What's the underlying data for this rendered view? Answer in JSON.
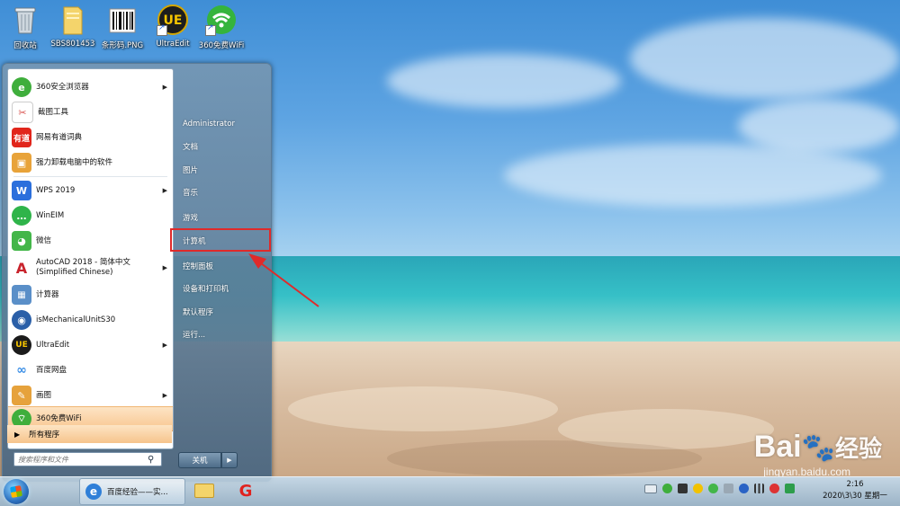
{
  "desktop": {
    "icons": [
      {
        "label": "回收站",
        "icon": "recycle-bin-icon"
      },
      {
        "label": "SBS801453",
        "icon": "folder-icon"
      },
      {
        "label": "条形码.PNG",
        "icon": "barcode-image-icon"
      },
      {
        "label": "UltraEdit",
        "icon": "ultraedit-icon"
      },
      {
        "label": "360免费WiFi",
        "icon": "wifi-icon"
      }
    ]
  },
  "start_menu": {
    "programs": [
      {
        "label": "360安全浏览器",
        "has_submenu": true,
        "color": "#3fae3c"
      },
      {
        "label": "截图工具",
        "has_submenu": false,
        "color": "#d9534f"
      },
      {
        "label": "网易有道词典",
        "has_submenu": false,
        "color": "#e1251b"
      },
      {
        "label": "强力卸载电脑中的软件",
        "has_submenu": false,
        "color": "#e8a33a"
      },
      {
        "label": "WPS 2019",
        "has_submenu": true,
        "color": "#2b6fdc"
      },
      {
        "label": "WinEIM",
        "has_submenu": false,
        "color": "#2fb44a"
      },
      {
        "label": "微信",
        "has_submenu": false,
        "color": "#43b649"
      },
      {
        "label": "AutoCAD 2018 - 简体中文\n(Simplified Chinese)",
        "has_submenu": true,
        "color": "#c8232c"
      },
      {
        "label": "计算器",
        "has_submenu": false,
        "color": "#5a8fc8"
      },
      {
        "label": "isMechanicalUnitS30",
        "has_submenu": false,
        "color": "#2a5fa8"
      },
      {
        "label": "UltraEdit",
        "has_submenu": true,
        "color": "#1b1b1b"
      },
      {
        "label": "百度网盘",
        "has_submenu": false,
        "color": "#3a8ee6"
      },
      {
        "label": "画图",
        "has_submenu": true,
        "color": "#e6a23c"
      },
      {
        "label": "360免费WiFi",
        "has_submenu": false,
        "color": "#3fae3c"
      }
    ],
    "all_programs_label": "所有程序",
    "search_placeholder": "搜索程序和文件",
    "right_items": [
      "Administrator",
      "文档",
      "图片",
      "音乐",
      "游戏",
      "计算机",
      "控制面板",
      "设备和打印机",
      "默认程序",
      "运行..."
    ],
    "shutdown_label": "关机"
  },
  "taskbar": {
    "active_window_label": "百度经验——实...",
    "clock_time": "2:16",
    "clock_date": "2020\\3\\30 星期一"
  },
  "watermark": {
    "brand": "Bai",
    "brand_suffix": "经验",
    "url": "jingyan.baidu.com"
  },
  "colors": {
    "highlight_box": "#e02a2a",
    "menu_hover": "#f8c58f"
  }
}
